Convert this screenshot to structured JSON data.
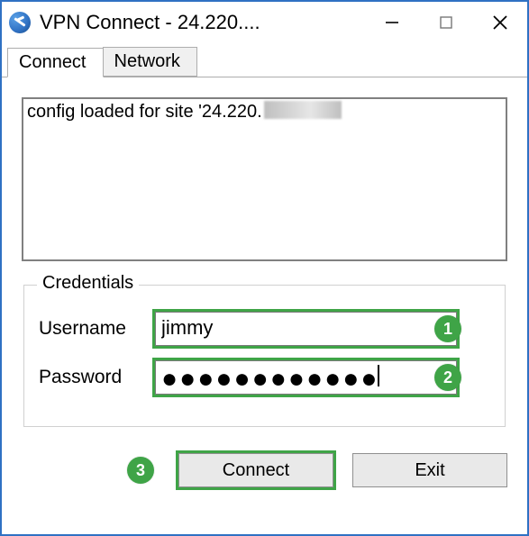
{
  "window": {
    "title": "VPN Connect - 24.220....",
    "icon": "vpn-globe-icon"
  },
  "win_controls": {
    "minimize": "minimize-icon",
    "maximize": "maximize-icon",
    "close": "close-icon"
  },
  "tabs": [
    {
      "label": "Connect",
      "active": true
    },
    {
      "label": "Network",
      "active": false
    }
  ],
  "log": {
    "line_prefix": "config loaded for site '24.220.",
    "redacted": true
  },
  "credentials": {
    "legend": "Credentials",
    "username_label": "Username",
    "username_value": "jimmy",
    "password_label": "Password",
    "password_masked": "●●●●●●●●●●●●",
    "password_length": 12
  },
  "buttons": {
    "connect_label": "Connect",
    "exit_label": "Exit"
  },
  "callouts": {
    "username": "1",
    "password": "2",
    "connect": "3"
  },
  "colors": {
    "accent_border": "#2f71c3",
    "highlight_green": "#3fa447"
  }
}
